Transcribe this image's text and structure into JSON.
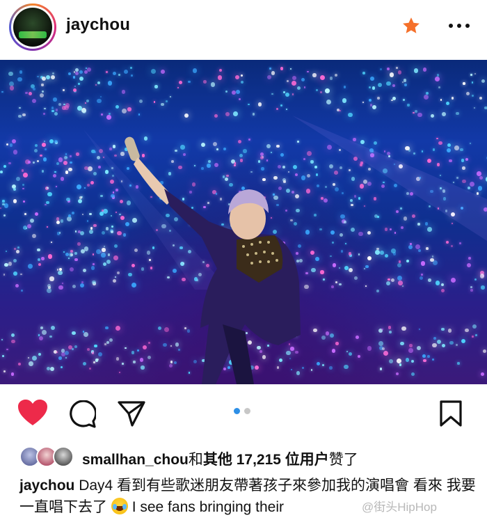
{
  "header": {
    "username": "jaychou",
    "avatar_icon": "profile-avatar",
    "favorite_icon": "star-icon",
    "favorite_color": "#f5702a",
    "more_icon": "more-options-icon"
  },
  "post": {
    "image_description_icon": "concert-photo",
    "carousel": {
      "current": 1,
      "total": 2,
      "active_color": "#2d8fe6"
    }
  },
  "actions": {
    "like_icon": "heart-icon",
    "like_color": "#ed2a4a",
    "comment_icon": "comment-icon",
    "share_icon": "share-icon",
    "save_icon": "bookmark-icon"
  },
  "likes": {
    "first_user": "smallhan_chou",
    "connector": "和",
    "others_text": "其他 17,215 位用户",
    "suffix": "赞了"
  },
  "caption": {
    "author": "jaychou",
    "text_part1": "Day4 看到有些歌迷朋友帶著孩子來參加我的演唱會 看來 我要一直唱下去了",
    "text_part2": "I see fans bringing their"
  },
  "watermark": "@街头HipHop"
}
